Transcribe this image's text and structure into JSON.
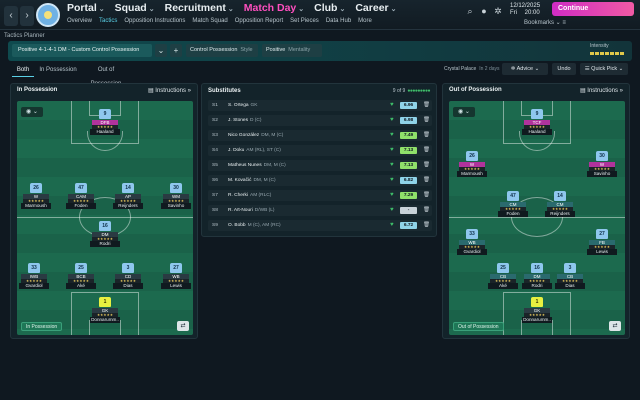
{
  "header": {
    "back": "‹",
    "forward": "›",
    "nav": [
      {
        "label": "Portal",
        "active": false
      },
      {
        "label": "Squad",
        "active": false
      },
      {
        "label": "Recruitment",
        "active": false
      },
      {
        "label": "Match Day",
        "active": true
      },
      {
        "label": "Club",
        "active": false
      },
      {
        "label": "Career",
        "active": false
      }
    ],
    "subnav": [
      "Overview",
      "Tactics",
      "Opposition Instructions",
      "Match Squad",
      "Opposition Report",
      "Set Pieces",
      "Data Hub",
      "More"
    ],
    "date": "12/12/2025",
    "day": "Fri",
    "time": "20:00",
    "continue_label": "Continue",
    "bookmarks_label": "Bookmarks"
  },
  "toolbar": {
    "planner_label": "Tactics Planner",
    "formation": "Positive 4-1-4-1 DM - Custom Control Possession",
    "add": "+",
    "style_value": "Control Possession",
    "style_key": "Style",
    "mentality_value": "Positive",
    "mentality_key": "Mentality",
    "intensity_label": "Intensity"
  },
  "tabs": [
    "Both",
    "In Possession",
    "Out of Possession"
  ],
  "opponent": {
    "name": "Crystal Palace",
    "when": "In 2 days"
  },
  "actions": {
    "advice": "Advice",
    "undo": "Undo",
    "quick_pick": "Quick Pick"
  },
  "in_possession": {
    "title": "In Possession",
    "instructions": "Instructions",
    "phase_label": "In Possession",
    "players": [
      {
        "num": "1",
        "pos": "GK",
        "style": "gk",
        "name": "Donnarumm.."
      },
      {
        "num": "33",
        "pos": "IWB",
        "style": "dark",
        "name": "Gvardiol"
      },
      {
        "num": "25",
        "pos": "BCB",
        "style": "dark",
        "name": "Aké"
      },
      {
        "num": "3",
        "pos": "CD",
        "style": "dark",
        "name": "Dias"
      },
      {
        "num": "27",
        "pos": "WB",
        "style": "dark",
        "name": "Lewis"
      },
      {
        "num": "16",
        "pos": "DM",
        "style": "dark",
        "name": "Rodri"
      },
      {
        "num": "26",
        "pos": "W",
        "style": "dark",
        "name": "Marmoush"
      },
      {
        "num": "47",
        "pos": "CAM",
        "style": "dark",
        "name": "Foden"
      },
      {
        "num": "14",
        "pos": "AP",
        "style": "dark",
        "name": "Reijnders"
      },
      {
        "num": "30",
        "pos": "WM",
        "style": "dark",
        "name": "Savinho"
      },
      {
        "num": "9",
        "pos": "DFB",
        "style": "pink",
        "name": "Haaland"
      }
    ]
  },
  "out_possession": {
    "title": "Out of Possession",
    "instructions": "Instructions",
    "phase_label": "Out of Possession",
    "players": [
      {
        "num": "1",
        "pos": "GK",
        "style": "gk",
        "name": "Donnarumm.."
      },
      {
        "num": "25",
        "pos": "CB",
        "style": "teal",
        "name": "Aké"
      },
      {
        "num": "16",
        "pos": "DM",
        "style": "teal",
        "name": "Rodri"
      },
      {
        "num": "3",
        "pos": "CB",
        "style": "teal",
        "name": "Dias"
      },
      {
        "num": "33",
        "pos": "WB",
        "style": "teal",
        "name": "Gvardiol"
      },
      {
        "num": "27",
        "pos": "FB",
        "style": "teal",
        "name": "Lewis"
      },
      {
        "num": "47",
        "pos": "CM",
        "style": "teal",
        "name": "Foden"
      },
      {
        "num": "14",
        "pos": "CM",
        "style": "teal",
        "name": "Reijnders"
      },
      {
        "num": "26",
        "pos": "W",
        "style": "pink",
        "name": "Marmoush"
      },
      {
        "num": "30",
        "pos": "W",
        "style": "pink",
        "name": "Savinho"
      },
      {
        "num": "9",
        "pos": "TCF",
        "style": "pink",
        "name": "Haaland"
      }
    ]
  },
  "substitutes": {
    "title": "Substitutes",
    "count": "9 of 9",
    "rows": [
      {
        "num": "S1",
        "name": "S. Ortega",
        "role": "GK",
        "rating": "6.96",
        "color": "#8fd3e8",
        "heart": "#3fbf6a"
      },
      {
        "num": "S2",
        "name": "J. Stones",
        "role": "D (C)",
        "rating": "6.98",
        "color": "#8fd3e8",
        "heart": "#3fbf6a"
      },
      {
        "num": "S3",
        "name": "Nico González",
        "role": "DM, M (C)",
        "rating": "7.49",
        "color": "#8fe06a",
        "heart": "#3fbf6a"
      },
      {
        "num": "S4",
        "name": "J. Doku",
        "role": "AM (RL), ST (C)",
        "rating": "7.13",
        "color": "#8fe06a",
        "heart": "#3fbf6a"
      },
      {
        "num": "S5",
        "name": "Matheus Nunes",
        "role": "DM, M (C)",
        "rating": "7.13",
        "color": "#8fe06a",
        "heart": "#3fbf6a"
      },
      {
        "num": "S6",
        "name": "M. Kovačić",
        "role": "DM, M (C)",
        "rating": "6.82",
        "color": "#8fd3e8",
        "heart": "#3fbf6a"
      },
      {
        "num": "S7",
        "name": "R. Cherki",
        "role": "AM (RLC)",
        "rating": "7.29",
        "color": "#8fe06a",
        "heart": "#3fbf6a"
      },
      {
        "num": "S8",
        "name": "R. Aït-Nouri",
        "role": "D/WB (L)",
        "rating": "-",
        "color": "#c8d2d8",
        "heart": "#3fbf6a"
      },
      {
        "num": "S9",
        "name": "O. Bobb",
        "role": "M (C), AM (RC)",
        "rating": "6.72",
        "color": "#8fd3e8",
        "heart": "#3fbf6a"
      }
    ]
  }
}
